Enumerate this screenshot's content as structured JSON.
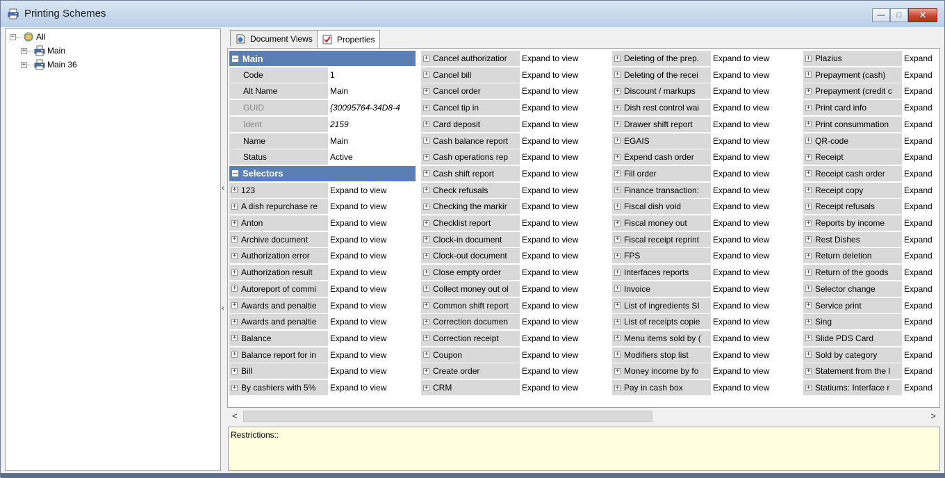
{
  "window": {
    "title": "Printing Schemes",
    "minimize": "—",
    "maximize": "□",
    "close": "✕"
  },
  "tree": {
    "root": "All",
    "children": [
      "Main",
      "Main 36"
    ]
  },
  "tabs": [
    {
      "label": "Document Views",
      "active": false
    },
    {
      "label": "Properties",
      "active": true
    }
  ],
  "grid": {
    "expand_label": "Expand to view",
    "expand_short": "Expand",
    "main_header": "Main",
    "selectors_header": "Selectors",
    "main_props": [
      {
        "key": "Code",
        "value": "1"
      },
      {
        "key": "Alt Name",
        "value": "Main"
      },
      {
        "key": "GUID",
        "value": "{30095764-34D8-4",
        "dim": true
      },
      {
        "key": "Ident",
        "value": "2159",
        "dim": true
      },
      {
        "key": "Name",
        "value": "Main"
      },
      {
        "key": "Status",
        "value": "Active"
      }
    ],
    "col1": [
      "123",
      "A dish repurchase re",
      "Anton",
      "Archive document",
      "Authorization error",
      "Authorization result",
      "Autoreport of commi",
      "Awards and penaltie",
      "Awards and penaltie",
      "Balance",
      "Balance report for in",
      "Bill",
      "By cashiers with 5%"
    ],
    "col2": [
      "Cancel authorizatior",
      "Cancel bill",
      "Cancel order",
      "Cancel tip in",
      "Card deposit",
      "Cash balance report",
      "Cash operations rep",
      "Cash shift report",
      "Check refusals",
      "Checking the markir",
      "Checklist report",
      "Clock-in document",
      "Clock-out document",
      "Close empty order",
      "Collect money out ol",
      "Common shift report",
      "Correction documen",
      "Correction receipt",
      "Coupon",
      "Create order",
      "CRM"
    ],
    "col3": [
      "Deleting of the prep.",
      "Deleting of the recei",
      "Discount / markups",
      "Dish rest control wai",
      "Drawer shift report",
      "EGAIS",
      "Expend cash order",
      "Fill order",
      "Finance transaction:",
      "Fiscal dish void",
      "Fiscal money out",
      "Fiscal receipt reprint",
      "FPS",
      "Interfaces reports",
      "Invoice",
      "List of ingredients SI",
      "List of receipts copie",
      "Menu items sold by (",
      "Modifiers stop list",
      "Money income by fo",
      "Pay in cash box"
    ],
    "col4": [
      "Plazius",
      "Prepayment (cash)",
      "Prepayment (credit c",
      "Print card info",
      "Print consummation",
      "QR-code",
      "Receipt",
      "Receipt cash order",
      "Receipt copy",
      "Receipt refusals",
      "Reports by income",
      "Rest Dishes",
      "Return deletion",
      "Return of the goods",
      "Selector change",
      "Service print",
      "Sing",
      "Slide PDS Card",
      "Sold by category",
      "Statement from the l",
      "Statiums: Interface r"
    ]
  },
  "scroll": {
    "left": "<",
    "right": ">"
  },
  "restrictions": {
    "label": "Restrictions::"
  },
  "colors": {
    "header_bg": "#5b7fb4",
    "key_bg": "#d9d9d9",
    "restrictions_bg": "#ffffe0"
  }
}
